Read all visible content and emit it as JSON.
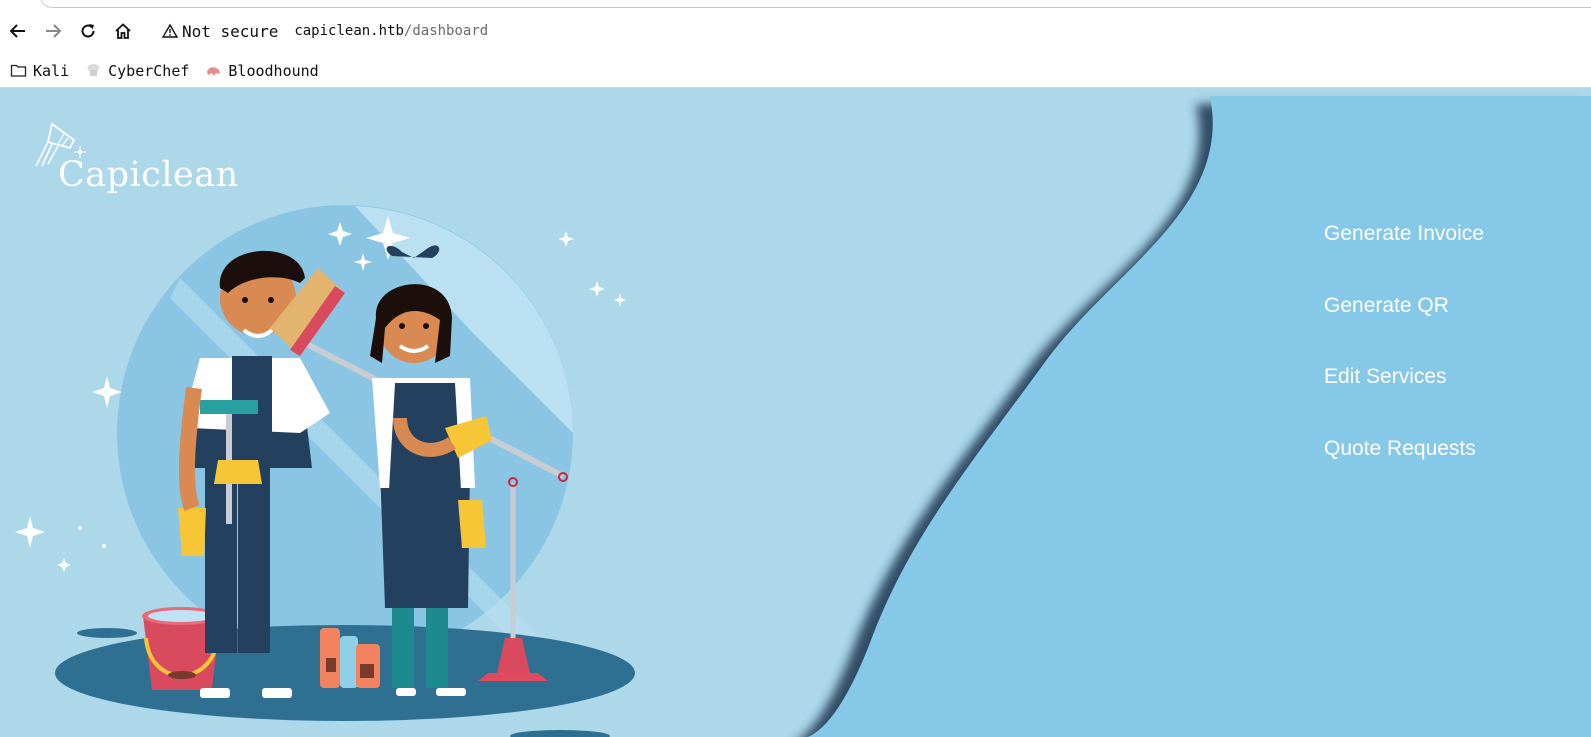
{
  "browser": {
    "security_label": "Not secure",
    "url_host": "capiclean.htb",
    "url_path": "/dashboard",
    "nav_icons": [
      "back-arrow-icon",
      "forward-arrow-icon",
      "reload-icon",
      "home-icon"
    ],
    "bookmarks": [
      {
        "label": "Kali",
        "icon": "folder-icon"
      },
      {
        "label": "CyberChef",
        "icon": "cyberchef-icon"
      },
      {
        "label": "Bloodhound",
        "icon": "bloodhound-icon"
      }
    ]
  },
  "site": {
    "logo_text": "Capiclean",
    "menu": [
      {
        "label": "Generate Invoice"
      },
      {
        "label": "Generate QR"
      },
      {
        "label": "Edit Services"
      },
      {
        "label": "Quote Requests"
      }
    ],
    "colors": {
      "background_light": "#acd8ea",
      "panel_blue": "#86c8e8",
      "shadow": "#2b4c6a",
      "overall_navy": "#24405f",
      "glove_yellow": "#f6c637",
      "bucket_red": "#d94a5e"
    }
  }
}
